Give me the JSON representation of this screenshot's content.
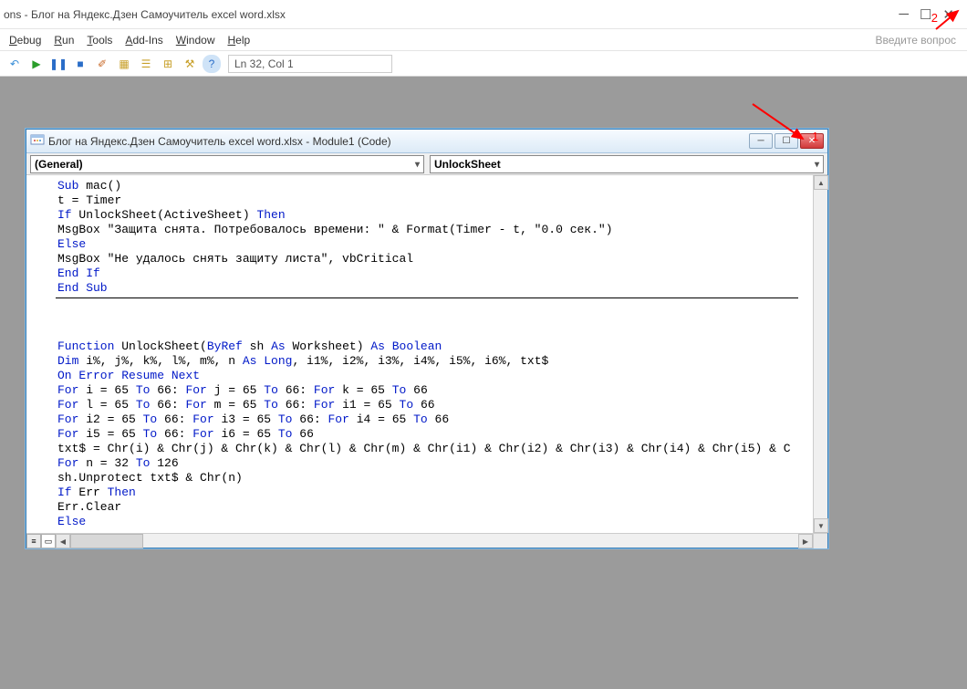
{
  "main": {
    "title": "ons - Блог на Яндекс.Дзен Самоучитель excel word.xlsx",
    "help_prompt": "Введите вопрос"
  },
  "menu": {
    "debug": "Debug",
    "run": "Run",
    "tools": "Tools",
    "addins": "Add-Ins",
    "window": "Window",
    "help": "Help"
  },
  "toolbar": {
    "cursor": "Ln 32, Col 1"
  },
  "child": {
    "title": "Блог на Яндекс.Дзен Самоучитель excel word.xlsx - Module1 (Code)",
    "left_combo": "(General)",
    "right_combo": "UnlockSheet"
  },
  "code": {
    "l1a": "Sub",
    "l1b": " mac()",
    "l2": "t = Timer",
    "l3a": "If",
    "l3b": " UnlockSheet(ActiveSheet) ",
    "l3c": "Then",
    "l4": "MsgBox \"Защита снята. Потребовалось времени: \" & Format(Timer - t, \"0.0 сек.\")",
    "l5": "Else",
    "l6": "MsgBox \"Не удалось снять защиту листа\", vbCritical",
    "l7": "End If",
    "l8": "End Sub",
    "l10a": "Function",
    "l10b": " UnlockSheet(",
    "l10c": "ByRef",
    "l10d": " sh ",
    "l10e": "As",
    "l10f": " Worksheet) ",
    "l10g": "As Boolean",
    "l11a": "Dim",
    "l11b": " i%, j%, k%, l%, m%, n ",
    "l11c": "As Long",
    "l11d": ", i1%, i2%, i3%, i4%, i5%, i6%, txt$",
    "l12": "On Error Resume Next",
    "l13a": "For",
    "l13b": " i = 65 ",
    "l13c": "To",
    "l13d": " 66: ",
    "l13e": "For",
    "l13f": " j = 65 ",
    "l13g": "To",
    "l13h": " 66: ",
    "l13i": "For",
    "l13j": " k = 65 ",
    "l13k": "To",
    "l13l": " 66",
    "l14a": "For",
    "l14b": " l = 65 ",
    "l14c": "To",
    "l14d": " 66: ",
    "l14e": "For",
    "l14f": " m = 65 ",
    "l14g": "To",
    "l14h": " 66: ",
    "l14i": "For",
    "l14j": " i1 = 65 ",
    "l14k": "To",
    "l14l": " 66",
    "l15a": "For",
    "l15b": " i2 = 65 ",
    "l15c": "To",
    "l15d": " 66: ",
    "l15e": "For",
    "l15f": " i3 = 65 ",
    "l15g": "To",
    "l15h": " 66: ",
    "l15i": "For",
    "l15j": " i4 = 65 ",
    "l15k": "To",
    "l15l": " 66",
    "l16a": "For",
    "l16b": " i5 = 65 ",
    "l16c": "To",
    "l16d": " 66: ",
    "l16e": "For",
    "l16f": " i6 = 65 ",
    "l16g": "To",
    "l16h": " 66",
    "l17": "txt$ = Chr(i) & Chr(j) & Chr(k) & Chr(l) & Chr(m) & Chr(i1) & Chr(i2) & Chr(i3) & Chr(i4) & Chr(i5) & C",
    "l18a": "For",
    "l18b": " n = 32 ",
    "l18c": "To",
    "l18d": " 126",
    "l19": "sh.Unprotect txt$ & Chr(n)",
    "l20a": "If",
    "l20b": " Err ",
    "l20c": "Then",
    "l21": "Err.Clear",
    "l22": "Else"
  },
  "annotations": {
    "a1": "1",
    "a2": "2"
  }
}
